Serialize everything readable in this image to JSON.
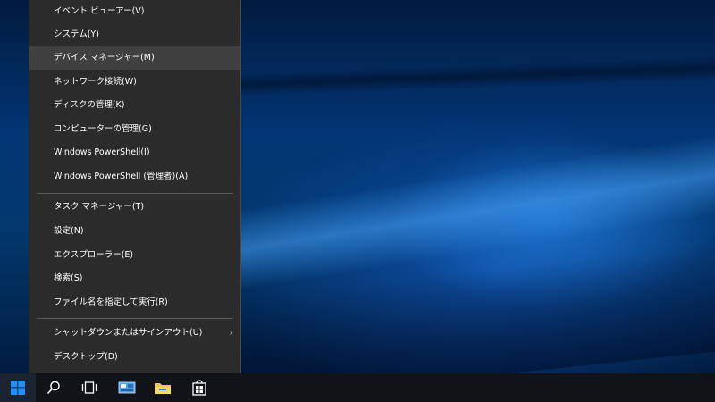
{
  "menu": {
    "items": [
      {
        "label": "イベント ビューアー(V)"
      },
      {
        "label": "システム(Y)"
      },
      {
        "label": "デバイス マネージャー(M)"
      },
      {
        "label": "ネットワーク接続(W)"
      },
      {
        "label": "ディスクの管理(K)"
      },
      {
        "label": "コンピューターの管理(G)"
      },
      {
        "label": "Windows PowerShell(I)"
      },
      {
        "label": "Windows PowerShell (管理者)(A)"
      },
      {
        "label": "タスク マネージャー(T)"
      },
      {
        "label": "設定(N)"
      },
      {
        "label": "エクスプローラー(E)"
      },
      {
        "label": "検索(S)"
      },
      {
        "label": "ファイル名を指定して実行(R)"
      },
      {
        "label": "シャットダウンまたはサインアウト(U)"
      },
      {
        "label": "デスクトップ(D)"
      }
    ],
    "highlighted": "デバイス マネージャー(M)",
    "submenu_arrow": "›"
  },
  "taskbar": {
    "icons": [
      "windows-logo-icon",
      "search-icon",
      "task-view-icon",
      "control-panel-icon",
      "file-explorer-icon",
      "store-icon"
    ]
  },
  "colors": {
    "menu_bg": "#2b2b2b",
    "menu_highlight": "#404040",
    "taskbar_bg": "#101418",
    "accent_blue": "#0078d7"
  }
}
